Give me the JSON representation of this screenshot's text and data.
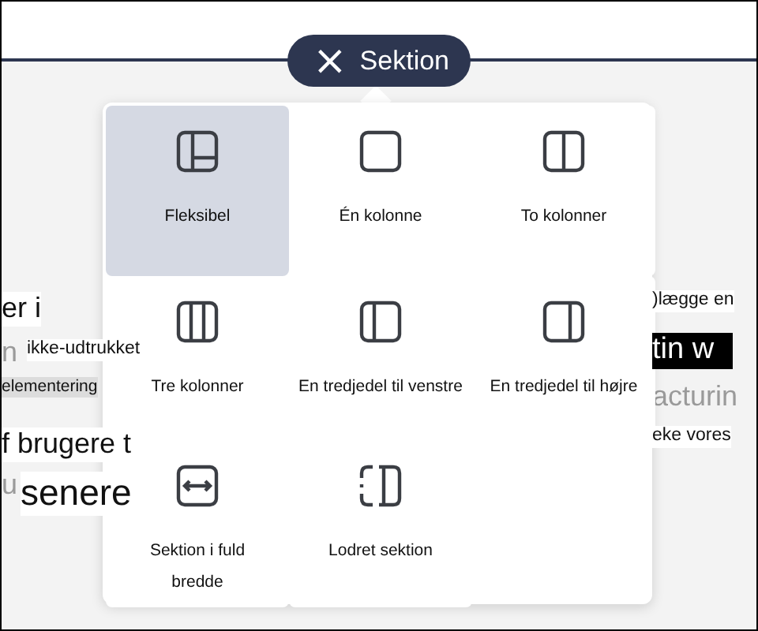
{
  "section_pill": {
    "close_glyph": "×",
    "label": "Sektion"
  },
  "page_fragments_left": [
    {
      "text": "er i",
      "kind": "large"
    },
    {
      "text": "n",
      "kind": "faded"
    },
    {
      "text": "ikke-udtrukket",
      "kind": "small"
    },
    {
      "text": "elementering",
      "kind": "shaded"
    },
    {
      "text": "f brugere t",
      "kind": "large"
    },
    {
      "text": "u",
      "kind": "faded"
    },
    {
      "text": "senere",
      "kind": "huge"
    }
  ],
  "page_fragments_right": [
    {
      "text": ")lægge en",
      "kind": "small"
    },
    {
      "text": "tin w",
      "kind": "inverse"
    },
    {
      "text": "acturin",
      "kind": "faded"
    },
    {
      "text": "eke vores",
      "kind": "small"
    }
  ],
  "layouts": [
    {
      "label": "Fleksibel",
      "selected": true
    },
    {
      "label": "Én kolonne",
      "selected": false
    },
    {
      "label": "To kolonner",
      "selected": false
    },
    {
      "label": "Tre kolonner",
      "selected": false
    },
    {
      "label": "En tredjedel til venstre",
      "selected": false
    },
    {
      "label": "En tredjedel til højre",
      "selected": false
    },
    {
      "label": "Sektion i fuld bredde",
      "selected": false
    },
    {
      "label": "Lodret sektion",
      "selected": false
    }
  ]
}
